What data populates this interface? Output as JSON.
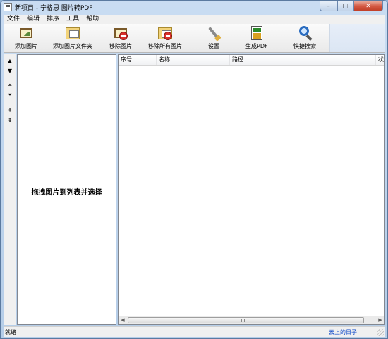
{
  "window": {
    "title": "新项目 - 宁格思 图片转PDF",
    "minimize_glyph": "–",
    "maximize_glyph": "□",
    "close_glyph": "✕"
  },
  "menu": [
    "文件",
    "编辑",
    "排序",
    "工具",
    "帮助"
  ],
  "toolbar": {
    "add_image": "添加图片",
    "add_folder": "添加图片文件夹",
    "remove_image": "移除图片",
    "remove_all": "移除所有图片",
    "settings": "设置",
    "generate_pdf": "生成PDF",
    "quick_search": "快捷搜索"
  },
  "arrows": {
    "up": "▲",
    "down": "▼",
    "top": "⏶",
    "bottom": "⏷",
    "page_up": "⇞",
    "page_down": "⇟"
  },
  "thumb_pane": {
    "hint": "拖拽图片到列表并选择"
  },
  "list": {
    "columns": [
      "序号",
      "名称",
      "路径",
      "状"
    ]
  },
  "status": {
    "text": "就绪",
    "link": "云上的日子"
  }
}
